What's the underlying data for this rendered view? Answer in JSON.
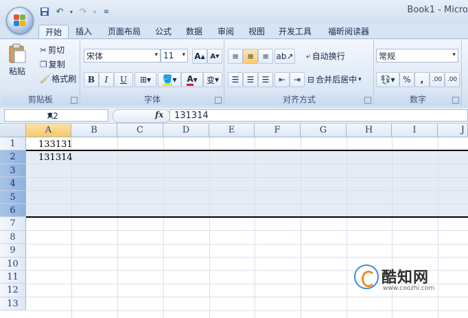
{
  "window": {
    "title": "Book1 - Micro"
  },
  "quick_access": {
    "save_icon": "save-icon",
    "undo_icon": "undo-icon",
    "redo_icon": "redo-icon",
    "customize_icon": "customize-qat-icon"
  },
  "tabs": [
    "开始",
    "插入",
    "页面布局",
    "公式",
    "数据",
    "审阅",
    "视图",
    "开发工具",
    "福昕阅读器"
  ],
  "active_tab": "开始",
  "ribbon": {
    "clipboard": {
      "label": "剪贴板",
      "paste": "粘贴",
      "cut": "剪切",
      "copy": "复制",
      "format_painter": "格式刷"
    },
    "font": {
      "label": "字体",
      "font_name": "宋体",
      "font_size": "11",
      "bold": "B",
      "italic": "I",
      "underline": "U",
      "font_color_glyph": "A",
      "phonetic": "变"
    },
    "alignment": {
      "label": "对齐方式",
      "wrap_text": "自动换行",
      "merge_center": "合并后居中"
    },
    "number": {
      "label": "数字",
      "format": "常规",
      "percent": "%",
      "comma": ",",
      "inc_decimal": ".00",
      "dec_decimal": ".00"
    }
  },
  "formula_bar": {
    "name_box": "A2",
    "fx": "fx",
    "content": "131314"
  },
  "columns": [
    "A",
    "B",
    "C",
    "D",
    "E",
    "F",
    "G",
    "H",
    "I",
    "J"
  ],
  "rows": [
    "1",
    "2",
    "3",
    "4",
    "5",
    "6",
    "7",
    "8",
    "9",
    "10",
    "11",
    "12",
    "13"
  ],
  "cells": {
    "A1": "133131",
    "A2": "131314"
  },
  "selected_rows": [
    "2",
    "3",
    "4",
    "5",
    "6"
  ],
  "selected_column": "A",
  "colors": {
    "accent": "#f6c86a",
    "selection_fill": "#e6ecf5",
    "header": "#dfe8f5"
  },
  "watermark": {
    "name": "酷知网",
    "url": "www.coozhi.com"
  }
}
